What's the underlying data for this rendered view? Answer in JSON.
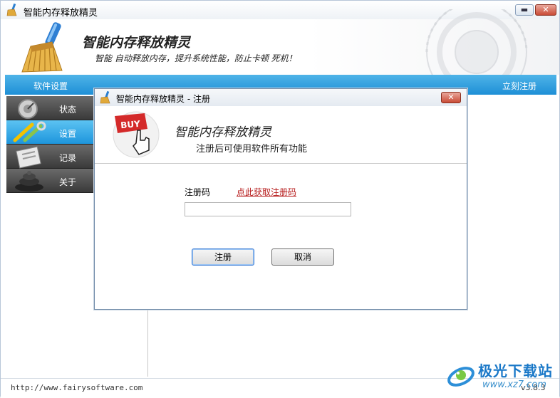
{
  "window": {
    "title": "智能内存释放精灵"
  },
  "header": {
    "app_title": "智能内存释放精灵",
    "slogan": "智能 自动释放内存，提升系统性能，防止卡顿 死机！"
  },
  "toolbar": {
    "settings_label": "软件设置",
    "register_label": "立刻注册"
  },
  "sidebar": {
    "items": [
      {
        "label": "状态",
        "icon": "gauge-icon",
        "active": false
      },
      {
        "label": "设置",
        "icon": "tools-icon",
        "active": true
      },
      {
        "label": "记录",
        "icon": "log-icon",
        "active": false
      },
      {
        "label": "关于",
        "icon": "about-icon",
        "active": false
      }
    ]
  },
  "statusbar": {
    "url": "http://www.fairysoftware.com",
    "version": "v3.8.3"
  },
  "watermark": {
    "text": "极光下载站",
    "url": "www.xz7.com"
  },
  "dialog": {
    "title": "智能内存释放精灵 - 注册",
    "banner_title": "智能内存释放精灵",
    "banner_subtitle": "注册后可使用软件所有功能",
    "buy_badge": "BUY",
    "code_label": "注册码",
    "get_code_link": "点此获取注册码",
    "code_value": "",
    "ok_button": "注册",
    "cancel_button": "取消"
  },
  "colors": {
    "accent": "#1e8fd6",
    "link": "#b51616",
    "close": "#c94b36"
  }
}
